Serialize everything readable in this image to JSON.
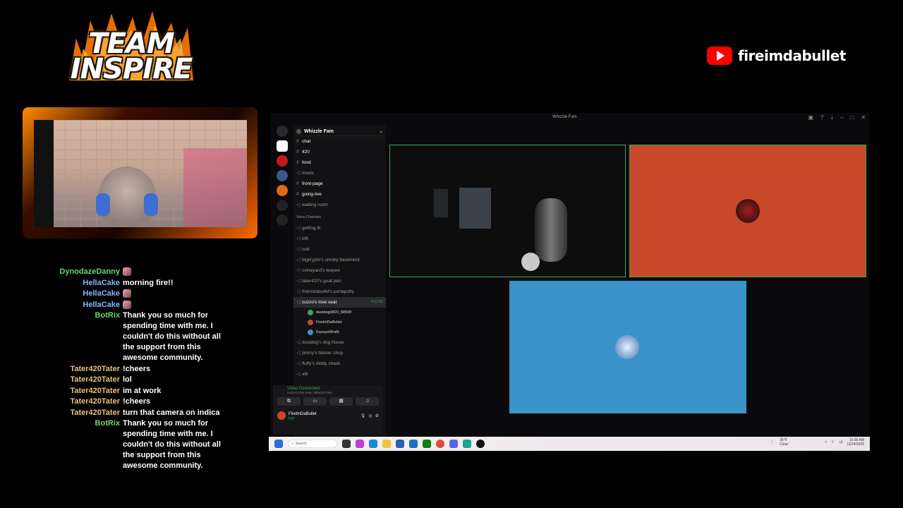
{
  "overlay": {
    "logo_line1": "TEAM",
    "logo_line2": "INSPIRE",
    "youtube_channel": "fireimdabullet"
  },
  "chat": [
    {
      "user": "DynodazeDanny",
      "color": "#6bd66b",
      "message": "",
      "emoji": true
    },
    {
      "user": "HellaCake",
      "color": "#8ab4f8",
      "message": "morning fire!!",
      "emoji": false
    },
    {
      "user": "HellaCake",
      "color": "#8ab4f8",
      "message": "",
      "emoji": true
    },
    {
      "user": "HellaCake",
      "color": "#8ab4f8",
      "message": "",
      "emoji": true
    },
    {
      "user": "BotRix",
      "color": "#6bd66b",
      "message": "Thank you so much for spending time with me. I couldn't do this without all the support from this awesome community.",
      "emoji": false
    },
    {
      "user": "Tater420Tater",
      "color": "#e6c07b",
      "message": "!cheers",
      "emoji": false
    },
    {
      "user": "Tater420Tater",
      "color": "#e6c07b",
      "message": "lol",
      "emoji": false
    },
    {
      "user": "Tater420Tater",
      "color": "#e6c07b",
      "message": "im at work",
      "emoji": false
    },
    {
      "user": "Tater420Tater",
      "color": "#e6c07b",
      "message": "!cheers",
      "emoji": false
    },
    {
      "user": "Tater420Tater",
      "color": "#e6c07b",
      "message": "turn that camera on indica",
      "emoji": false
    },
    {
      "user": "BotRix",
      "color": "#6bd66b",
      "message": "Thank you so much for spending time with me. I couldn't do this without all the support from this awesome community.",
      "emoji": false
    }
  ],
  "discord": {
    "window_title": "Whizzle Fam",
    "server_name": "Whizzle Fam",
    "text_channels": [
      {
        "name": "chat",
        "bold": true,
        "type": "text"
      },
      {
        "name": "420",
        "bold": true,
        "type": "text"
      },
      {
        "name": "food",
        "bold": true,
        "type": "text"
      },
      {
        "name": "music",
        "bold": false,
        "type": "voice"
      },
      {
        "name": "front-page",
        "bold": true,
        "type": "text"
      },
      {
        "name": "going-live",
        "bold": true,
        "type": "text"
      },
      {
        "name": "waiting room",
        "bold": false,
        "type": "voice"
      }
    ],
    "voice_category": "Voice Channels",
    "voice_channels_top": [
      "getting lit",
      "bf6",
      "cod",
      "bigkrypto's smoky basement",
      "cvineyard's teepee",
      "tater420's goat pen",
      "fireimdabullet's portapotty"
    ],
    "active_channel": {
      "name": "cuzzo's love seat",
      "time": "4:17:58"
    },
    "voice_users": [
      {
        "name": "dustdog0820_68508",
        "color": "#3ba55d"
      },
      {
        "name": "FireImDaBullet",
        "color": "#c8492a"
      },
      {
        "name": "KazuyaWrath",
        "color": "#3a94c9"
      }
    ],
    "voice_channels_bottom": [
      "dustdog's dog house",
      "jimmy's blinker shop",
      "fluffy's diddy shack",
      "afk"
    ],
    "connection_status": "Video Connected",
    "connection_location": "cuzzo's love seat / Whizzle Fam",
    "current_user": "FireImDaBullet",
    "current_user_status": "high"
  },
  "taskbar": {
    "search_placeholder": "Search",
    "weather_temp": "35°F",
    "weather_text": "Clear",
    "time": "10:36 AM",
    "date": "11/24/2025"
  }
}
